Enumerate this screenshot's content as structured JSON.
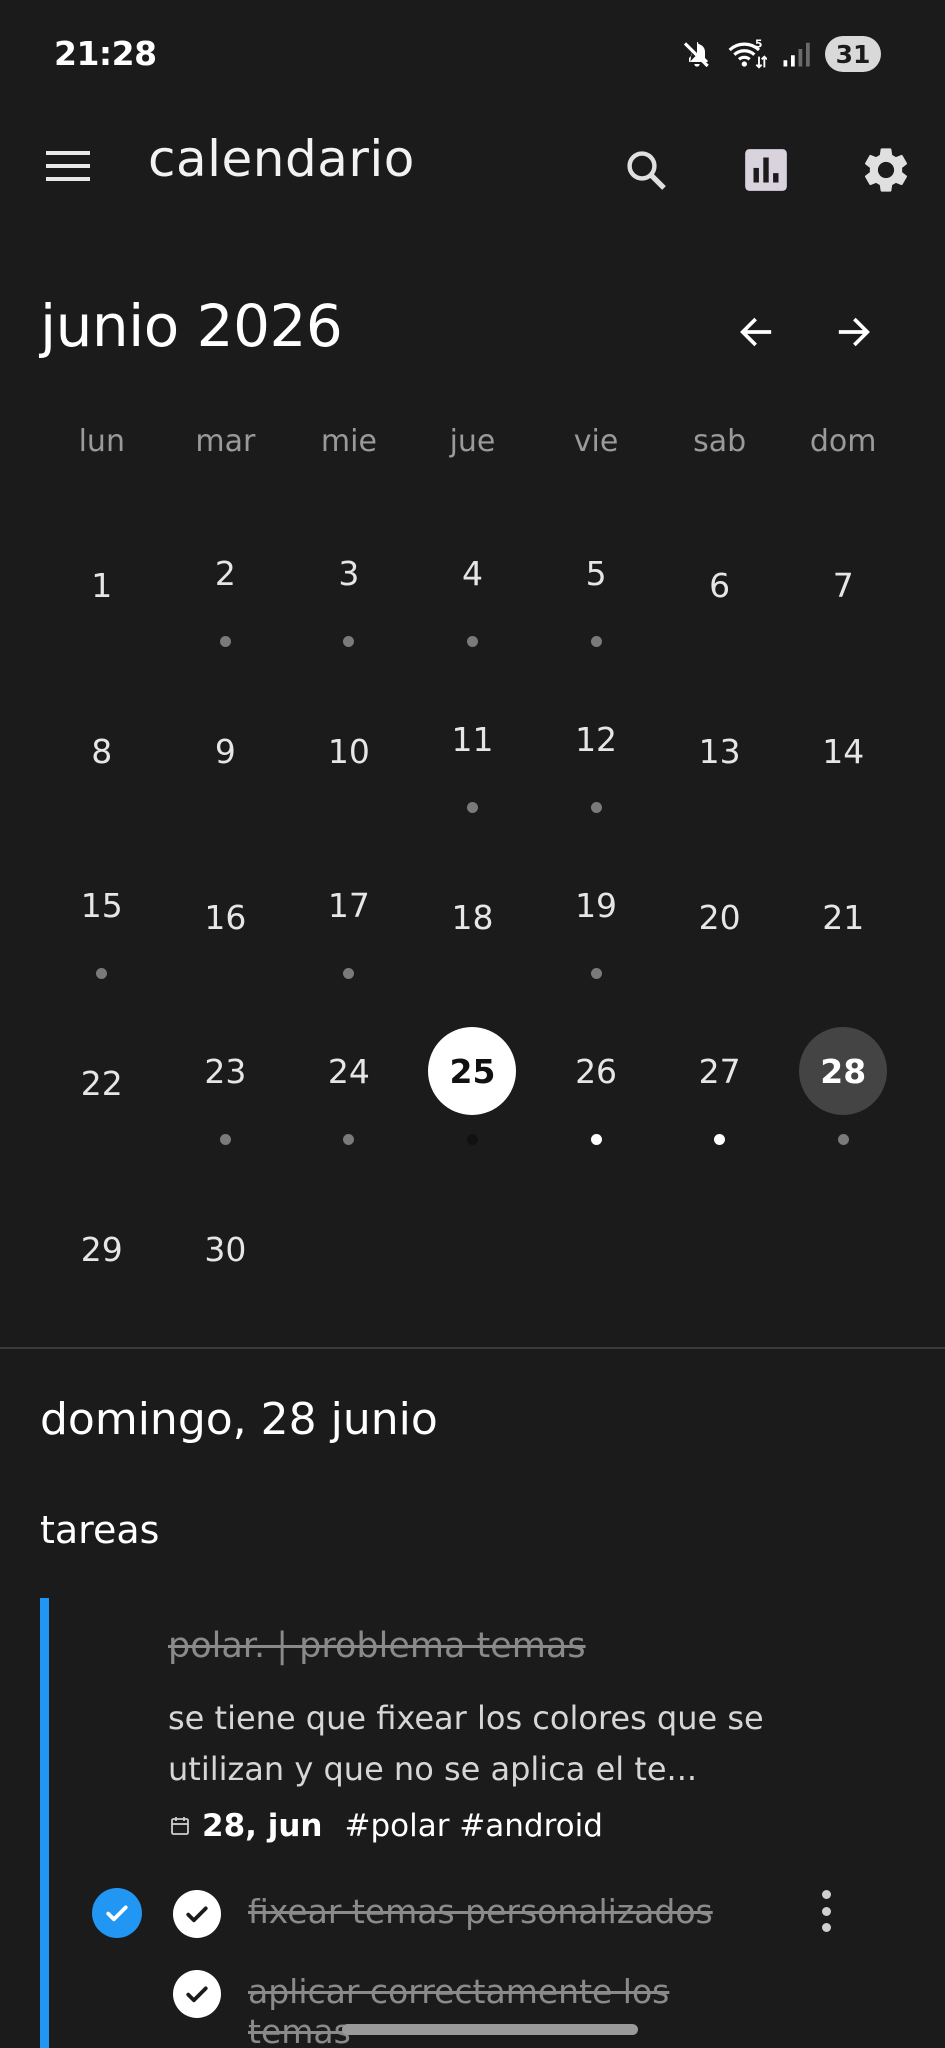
{
  "status_bar": {
    "time": "21:28",
    "battery": "31",
    "icons": [
      "mute-icon",
      "wifi-icon",
      "signal-icon",
      "battery-icon"
    ]
  },
  "app_bar": {
    "title": "calendario",
    "actions": [
      "search-icon",
      "stats-icon",
      "settings-icon"
    ]
  },
  "month": {
    "title": "junio 2026",
    "prev_icon": "arrow-left-icon",
    "next_icon": "arrow-right-icon"
  },
  "weekdays": [
    "lun",
    "mar",
    "mie",
    "jue",
    "vie",
    "sab",
    "dom"
  ],
  "days": [
    {
      "n": "1",
      "dot": null
    },
    {
      "n": "2",
      "dot": "gray"
    },
    {
      "n": "3",
      "dot": "gray"
    },
    {
      "n": "4",
      "dot": "gray"
    },
    {
      "n": "5",
      "dot": "gray"
    },
    {
      "n": "6",
      "dot": null
    },
    {
      "n": "7",
      "dot": null
    },
    {
      "n": "8",
      "dot": null
    },
    {
      "n": "9",
      "dot": null
    },
    {
      "n": "10",
      "dot": null
    },
    {
      "n": "11",
      "dot": "gray"
    },
    {
      "n": "12",
      "dot": "gray"
    },
    {
      "n": "13",
      "dot": null
    },
    {
      "n": "14",
      "dot": null
    },
    {
      "n": "15",
      "dot": "gray"
    },
    {
      "n": "16",
      "dot": null
    },
    {
      "n": "17",
      "dot": "gray"
    },
    {
      "n": "18",
      "dot": null
    },
    {
      "n": "19",
      "dot": "gray"
    },
    {
      "n": "20",
      "dot": null
    },
    {
      "n": "21",
      "dot": null
    },
    {
      "n": "22",
      "dot": null
    },
    {
      "n": "23",
      "dot": "gray"
    },
    {
      "n": "24",
      "dot": "gray"
    },
    {
      "n": "25",
      "dot": "dark",
      "state": "today"
    },
    {
      "n": "26",
      "dot": "white"
    },
    {
      "n": "27",
      "dot": "white"
    },
    {
      "n": "28",
      "dot": "gray",
      "state": "selected"
    },
    {
      "n": "29",
      "dot": null
    },
    {
      "n": "30",
      "dot": null
    }
  ],
  "selected_day": {
    "label": "domingo, 28 junio"
  },
  "tasks_section": {
    "title": "tareas",
    "task": {
      "title": "polar. | problema temas",
      "description": "se tiene que fixear los colores que se utilizan y que no se aplica el te...",
      "date": "28, jun",
      "tags": "#polar #android",
      "accent": "#2196f3",
      "completed": true,
      "subtasks": [
        {
          "label": "fixear temas personalizados",
          "done": true
        },
        {
          "label": "aplicar correctamente los temas",
          "done": true
        }
      ]
    }
  },
  "colors": {
    "background": "#1b1b1b",
    "accent": "#2196f3",
    "today_bg": "#ffffff",
    "selected_bg": "#444444"
  }
}
